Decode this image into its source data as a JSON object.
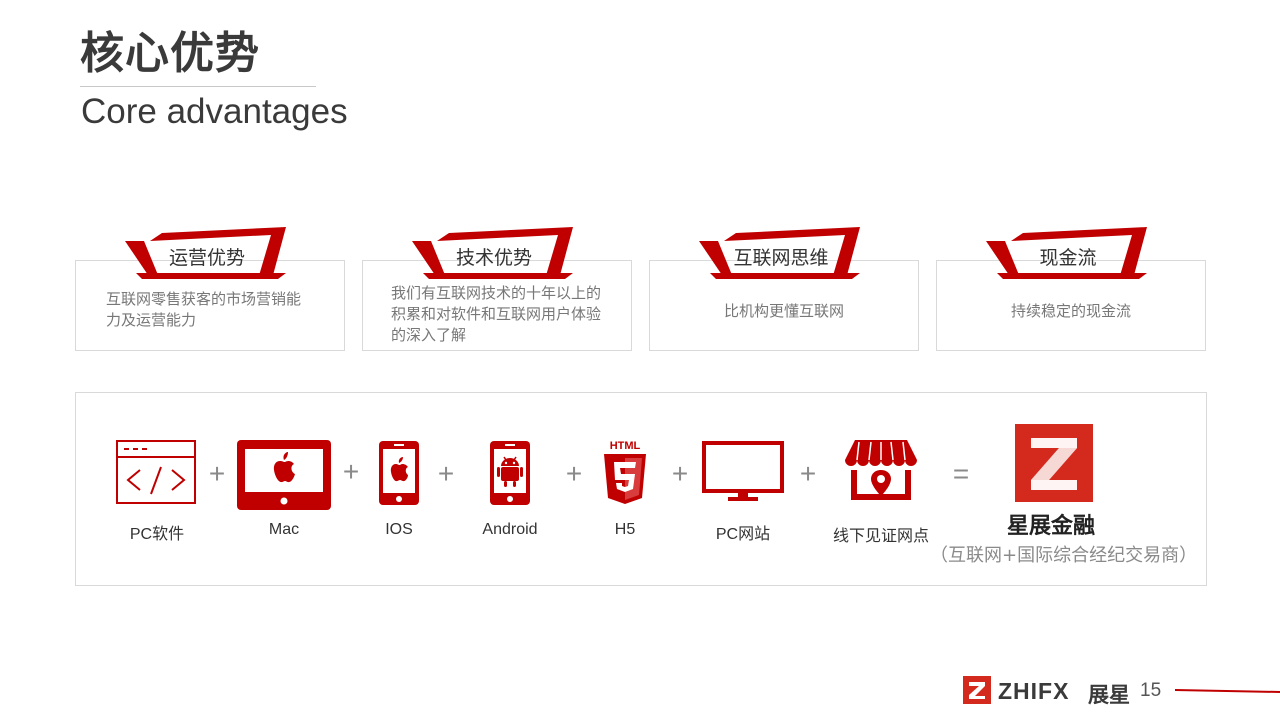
{
  "header": {
    "title": "核心优势",
    "subtitle": "Core advantages"
  },
  "cards": [
    {
      "title": "运营优势",
      "text": "互联网零售获客的市场营销能力及运营能力"
    },
    {
      "title": "技术优势",
      "text": "我们有互联网技术的十年以上的积累和对软件和互联网用户体验的深入了解"
    },
    {
      "title": "互联网思维",
      "text": "比机构更懂互联网"
    },
    {
      "title": "现金流",
      "text": "持续稳定的现金流"
    }
  ],
  "platforms": {
    "items": [
      {
        "label": "PC软件",
        "icon": "code-window-icon"
      },
      {
        "label": "Mac",
        "icon": "mac-monitor-icon"
      },
      {
        "label": "IOS",
        "icon": "iphone-icon"
      },
      {
        "label": "Android",
        "icon": "android-phone-icon"
      },
      {
        "label": "H5",
        "icon": "html5-icon"
      },
      {
        "label": "PC网站",
        "icon": "desktop-monitor-icon"
      },
      {
        "label": "线下见证网点",
        "icon": "storefront-location-icon"
      }
    ],
    "plus": "+",
    "equals": "=",
    "result_name": "星展金融",
    "result_desc": "（互联网+国际综合经纪交易商）"
  },
  "footer": {
    "brand": "ZHIFX",
    "brand_cn": "展星",
    "page_number": "15"
  },
  "colors": {
    "accent": "#c00000",
    "text": "#333333",
    "muted": "#777777"
  }
}
